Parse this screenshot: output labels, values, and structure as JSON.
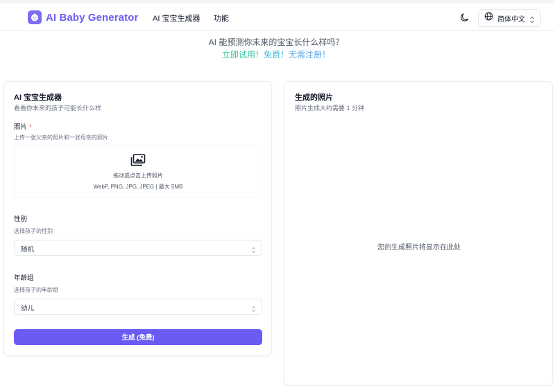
{
  "header": {
    "brand": "AI Baby Generator",
    "nav": [
      "AI 宝宝生成器",
      "功能"
    ],
    "language": "简体中文"
  },
  "hero": {
    "question": "AI 能预测你未来的宝宝长什么样吗？",
    "cta_try": "立即试用！",
    "cta_free": "免费！",
    "cta_noreg": "无需注册！"
  },
  "left": {
    "title": "AI 宝宝生成器",
    "subtitle": "看看你未来的孩子可能长什么样",
    "photo_label": "照片",
    "photo_required": "*",
    "photo_hint": "上传一张父亲的照片和一张母亲的照片",
    "dropzone_text": "拖动或点击上传照片",
    "dropzone_formats": "WebP, PNG, JPG, JPEG | 最大 5MB",
    "gender_label": "性别",
    "gender_hint": "选择孩子的性别",
    "gender_value": "随机",
    "age_label": "年龄组",
    "age_hint": "选择孩子的年龄组",
    "age_value": "幼儿",
    "generate_button": "生成 (免费)"
  },
  "right": {
    "title": "生成的照片",
    "subtitle": "照片生成大约需要 1 分钟",
    "placeholder": "您的生成照片将显示在此处"
  },
  "icons": {
    "logo": "baby-face-icon",
    "theme": "moon-icon",
    "language": "globe-icon",
    "upload": "images-icon",
    "select": "chevron-updown-icon"
  },
  "colors": {
    "brand": "#6d5ef3",
    "button": "#6a5cf2",
    "required": "#ef4444",
    "cta_green": "#34c4a0",
    "cta_teal": "#38b6d6",
    "cta_blue": "#5aa7e6"
  }
}
